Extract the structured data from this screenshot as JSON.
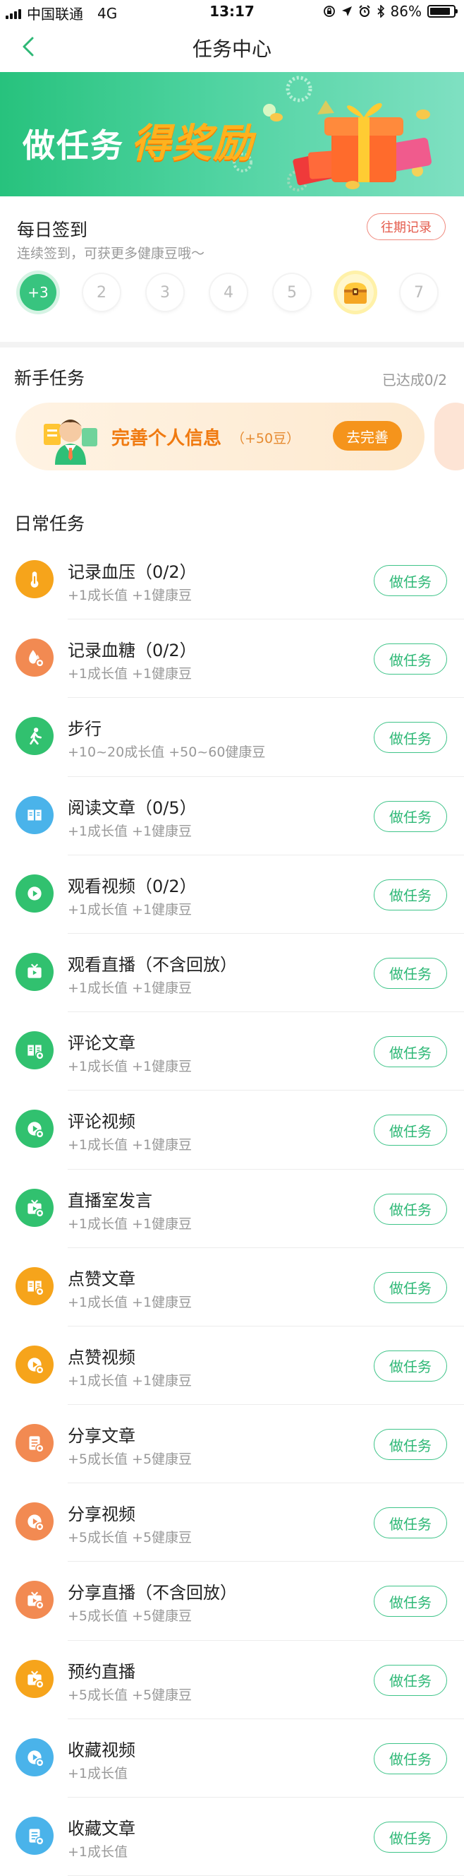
{
  "status_bar": {
    "carrier": "中国联通",
    "network": "4G",
    "time": "13:17",
    "battery": "86%",
    "battery_level": 0.86
  },
  "navbar": {
    "title": "任务中心"
  },
  "banner": {
    "text_plain": "做任务",
    "text_highlight": "得奖励"
  },
  "checkin": {
    "title": "每日签到",
    "subtitle": "连续签到，可获更多健康豆哦～",
    "history_button": "往期记录",
    "days": [
      "+3",
      "2",
      "3",
      "4",
      "5",
      "",
      "7"
    ]
  },
  "newbie": {
    "title": "新手任务",
    "progress": "已达成0/2",
    "card_label": "完善个人信息",
    "card_reward": "（+50豆）",
    "card_button": "去完善"
  },
  "daily": {
    "title": "日常任务",
    "button_label": "做任务",
    "tasks": [
      {
        "name": "记录血压（0/2）",
        "reward": "+1成长值    +1健康豆",
        "icon": "thermometer-icon",
        "color": "#f6a41b"
      },
      {
        "name": "记录血糖（0/2）",
        "reward": "+1成长值    +1健康豆",
        "icon": "blood-drop-icon",
        "color": "#f28a52"
      },
      {
        "name": "步行",
        "reward": "+10~20成长值    +50~60健康豆",
        "icon": "walking-icon",
        "color": "#31c16f"
      },
      {
        "name": "阅读文章（0/5）",
        "reward": "+1成长值    +1健康豆",
        "icon": "book-icon",
        "color": "#4ab3ea"
      },
      {
        "name": "观看视频（0/2）",
        "reward": "+1成长值    +1健康豆",
        "icon": "play-icon",
        "color": "#31c16f"
      },
      {
        "name": "观看直播（不含回放）",
        "reward": "+1成长值    +1健康豆",
        "icon": "tv-icon",
        "color": "#31c16f"
      },
      {
        "name": "评论文章",
        "reward": "+1成长值    +1健康豆",
        "icon": "book-comment-icon",
        "color": "#31c16f"
      },
      {
        "name": "评论视频",
        "reward": "+1成长值    +1健康豆",
        "icon": "play-comment-icon",
        "color": "#31c16f"
      },
      {
        "name": "直播室发言",
        "reward": "+1成长值    +1健康豆",
        "icon": "tv-comment-icon",
        "color": "#31c16f"
      },
      {
        "name": "点赞文章",
        "reward": "+1成长值    +1健康豆",
        "icon": "book-like-icon",
        "color": "#f6a41b"
      },
      {
        "name": "点赞视频",
        "reward": "+1成长值    +1健康豆",
        "icon": "play-like-icon",
        "color": "#f6a41b"
      },
      {
        "name": "分享文章",
        "reward": "+5成长值    +5健康豆",
        "icon": "doc-share-icon",
        "color": "#f28a52"
      },
      {
        "name": "分享视频",
        "reward": "+5成长值    +5健康豆",
        "icon": "play-share-icon",
        "color": "#f28a52"
      },
      {
        "name": "分享直播（不含回放）",
        "reward": "+5成长值    +5健康豆",
        "icon": "tv-share-icon",
        "color": "#f28a52"
      },
      {
        "name": "预约直播",
        "reward": "+5成长值    +5健康豆",
        "icon": "tv-reserve-icon",
        "color": "#f6a41b"
      },
      {
        "name": "收藏视频",
        "reward": "+1成长值",
        "icon": "play-favorite-icon",
        "color": "#4ab3ea"
      },
      {
        "name": "收藏文章",
        "reward": "+1成长值",
        "icon": "doc-favorite-icon",
        "color": "#4ab3ea"
      }
    ]
  }
}
